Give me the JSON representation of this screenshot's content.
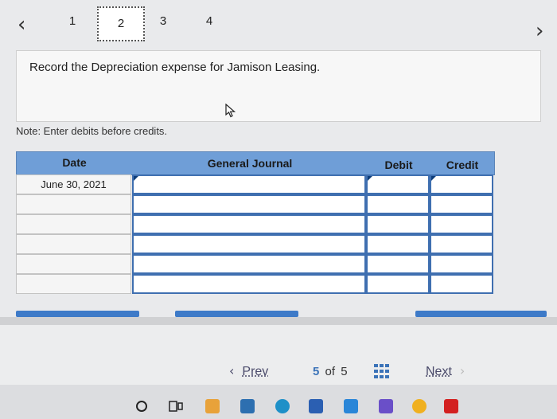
{
  "stepper": {
    "steps": [
      "1",
      "2",
      "3",
      "4"
    ],
    "active_index": 1
  },
  "prompt": {
    "text": "Record the Depreciation expense for Jamison Leasing."
  },
  "note": "Note: Enter debits before credits.",
  "journal": {
    "headers": {
      "date": "Date",
      "general_journal": "General Journal",
      "debit": "Debit",
      "credit": "Credit"
    },
    "rows": [
      {
        "date": "June 30, 2021"
      },
      {
        "date": ""
      },
      {
        "date": ""
      },
      {
        "date": ""
      },
      {
        "date": ""
      },
      {
        "date": ""
      }
    ]
  },
  "pager": {
    "prev_label": "Prev",
    "current_page": "5",
    "of_label": "of",
    "total_pages": "5",
    "next_label": "Next"
  },
  "colors": {
    "header_blue": "#6f9ed7",
    "cell_border": "#3f6fb0",
    "action_blue": "#3d7ac8"
  }
}
